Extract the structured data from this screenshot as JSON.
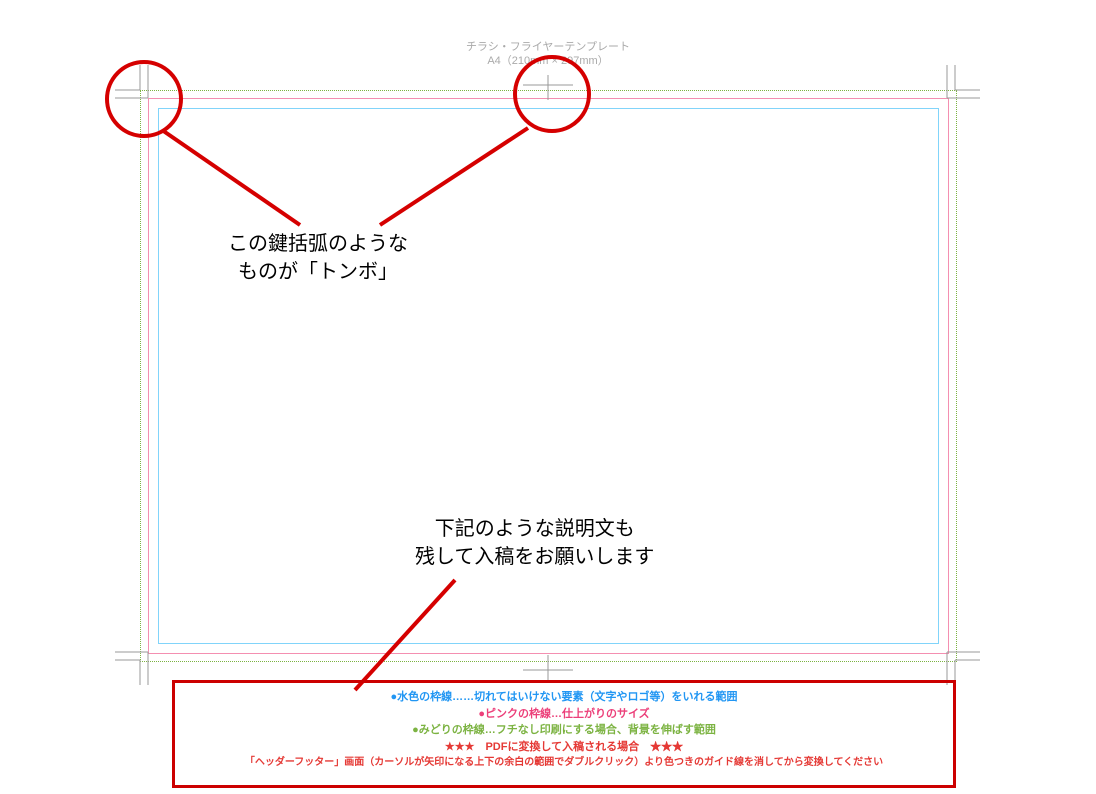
{
  "header": {
    "line1": "チラシ・フライヤーテンプレート",
    "line2": "A4（210mm × 297mm）"
  },
  "annotations": {
    "tombo_line1": "この鍵括弧のような",
    "tombo_line2": "ものが「トンボ」",
    "legend_line1": "下記のような説明文も",
    "legend_line2": "残して入稿をお願いします"
  },
  "legend": {
    "cyan_bullet": "●",
    "cyan_text": "水色の枠線……切れてはいけない要素（文字やロゴ等）をいれる範囲",
    "pink_bullet": "●",
    "pink_text": "ピンクの枠線…仕上がりのサイズ",
    "green_bullet": "●",
    "green_text": "みどりの枠線…フチなし印刷にする場合、背景を伸ばす範囲",
    "red_line1": "★★★　PDFに変換して入稿される場合　★★★",
    "red_line2": "「ヘッダーフッター」画面（カーソルが矢印になる上下の余白の範囲でダブルクリック）より色つきのガイド線を消してから変換してください"
  }
}
